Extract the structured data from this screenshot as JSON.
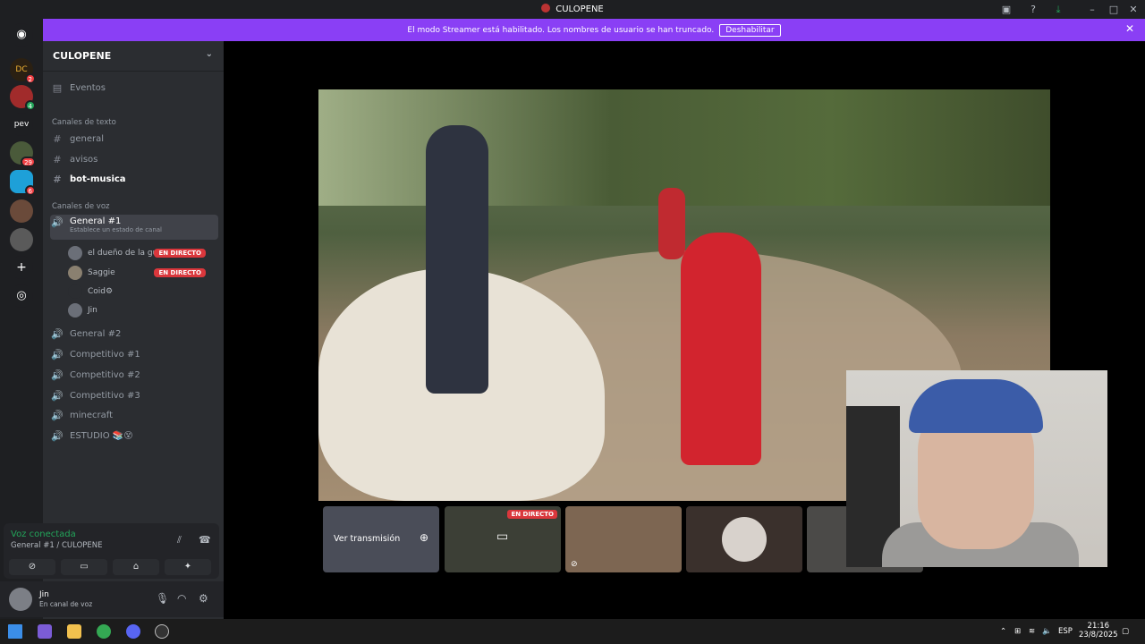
{
  "window": {
    "title": "CULOPENE"
  },
  "banner": {
    "message": "El modo Streamer está habilitado. Los nombres de usuario se han truncado.",
    "button": "Deshabilitar"
  },
  "servers": [
    {
      "label": "DC",
      "badge": "2"
    },
    {
      "label": "",
      "badge": "4"
    },
    {
      "label": "pev",
      "badge": ""
    },
    {
      "label": "",
      "badge": "29"
    },
    {
      "label": "",
      "badge": "6"
    },
    {
      "label": "",
      "badge": ""
    },
    {
      "label": "",
      "badge": ""
    }
  ],
  "sidebar": {
    "server_name": "CULOPENE",
    "events": "Eventos",
    "text_category": "Canales de texto",
    "text_channels": [
      "general",
      "avisos",
      "bot-musica"
    ],
    "voice_category": "Canales de voz",
    "active_voice": {
      "name": "General #1",
      "status": "Establece un estado de canal"
    },
    "voice_users": [
      {
        "name": "el dueño de la gu...",
        "live": "EN DIRECTO"
      },
      {
        "name": "Saggie",
        "live": "EN DIRECTO"
      },
      {
        "name": "Coid⚙",
        "live": ""
      },
      {
        "name": "Jin",
        "live": ""
      }
    ],
    "voice_channels": [
      "General #2",
      "Competitivo #1",
      "Competitivo #2",
      "Competitivo #3",
      "minecraft",
      "ESTUDIO 📚😵"
    ]
  },
  "voice_panel": {
    "status": "Voz conectada",
    "location": "General #1 / CULOPENE"
  },
  "user": {
    "name": "Jin",
    "status": "En canal de voz"
  },
  "stage": {
    "watch_label": "Ver transmisión",
    "live_tag": "EN DIRECTO"
  },
  "taskbar": {
    "lang": "ESP",
    "time": "21:16",
    "date": "23/8/2025"
  }
}
